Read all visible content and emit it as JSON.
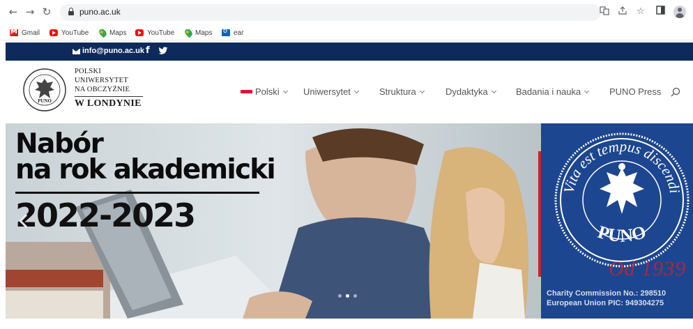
{
  "browser": {
    "url": "puno.ac.uk",
    "nav_icons": [
      "back-arrow-icon",
      "forward-arrow-icon",
      "reload-icon"
    ],
    "right_icons": [
      "translate-icon",
      "share-icon",
      "bookmark-star-icon",
      "side-panel-icon",
      "profile-icon"
    ]
  },
  "bookmarks": [
    {
      "label": "Gmail",
      "icon": "gmail-icon"
    },
    {
      "label": "YouTube",
      "icon": "youtube-icon"
    },
    {
      "label": "Maps",
      "icon": "maps-icon"
    },
    {
      "label": "YouTube",
      "icon": "youtube-icon"
    },
    {
      "label": "Maps",
      "icon": "maps-icon"
    },
    {
      "label": "ear",
      "icon": "outlook-icon"
    }
  ],
  "topbar": {
    "email": "info@puno.ac.uk",
    "social": [
      "facebook-icon",
      "twitter-icon"
    ],
    "background": "#0e2a5c"
  },
  "logo": {
    "line1": "POLSKI",
    "line2": "UNIWERSYTET",
    "line3": "NA OBCZYŹNIE",
    "line4": "W LONDYNIE",
    "seal_text_top": "Vita est tempus discendi",
    "seal_text_bottom": "PUNO"
  },
  "menu": {
    "items": [
      "Polski",
      "Uniwersytet",
      "Struktura",
      "Dydaktyka",
      "Badania i nauka",
      "PUNO Press"
    ],
    "accent": "#dc143c"
  },
  "hero": {
    "title_line1": "Nabór",
    "title_line2": "na rok akademicki",
    "year": "2022-2023",
    "seal_motto": "Vita est tempus discendi",
    "seal_name": "PUNO",
    "od_year": "Od 1939",
    "charity_line1": "Charity Commission No.: 298510",
    "charity_line2": "European Union PIC: 949304275",
    "panel_color": "#1d4690",
    "slides": 3,
    "active_slide": 2
  }
}
